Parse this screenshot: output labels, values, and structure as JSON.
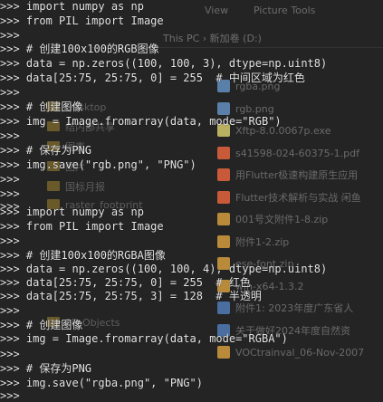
{
  "explorer": {
    "ribbon_tabs": [
      "View",
      "Picture Tools"
    ],
    "address_path": "This PC  ›  新加卷 (D:)",
    "nav_items": [
      "Desktop",
      "结内部共享",
      "图表",
      "图片",
      "国标月报",
      "raster_footprint",
      "3D Objects"
    ],
    "files": [
      {
        "name": "rgba.png",
        "icon": "png-icon",
        "color": "#5a7fa8"
      },
      {
        "name": "rgb.png",
        "icon": "png-icon",
        "color": "#5a7fa8"
      },
      {
        "name": "Xftp-8.0.0067p.exe",
        "icon": "exe-icon",
        "color": "#b9b062"
      },
      {
        "name": "s41598-024-60375-1.pdf",
        "icon": "pdf-icon",
        "color": "#c85a3a"
      },
      {
        "name": "用Flutter极速构建原生应用",
        "icon": "pdf-icon",
        "color": "#c85a3a"
      },
      {
        "name": "Flutter技术解析与实战 闲鱼",
        "icon": "pdf-icon",
        "color": "#c85a3a"
      },
      {
        "name": "001号文附件1-8.zip",
        "icon": "zip-icon",
        "color": "#b88a3a"
      },
      {
        "name": "附件1-2.zip",
        "icon": "zip-icon",
        "color": "#b88a3a"
      },
      {
        "name": "ese-font.zip",
        "icon": "zip-icon",
        "color": "#b88a3a"
      },
      {
        "name": "win-x64-1.3.2",
        "icon": "zip-icon",
        "color": "#b88a3a"
      },
      {
        "name": "附件1: 2023年度广东省人",
        "icon": "doc-icon",
        "color": "#4a6ea0"
      },
      {
        "name": "关于做好2024年度自然资",
        "icon": "doc-icon",
        "color": "#4a6ea0"
      },
      {
        "name": "VOCtrainval_06-Nov-2007",
        "icon": "zip-icon",
        "color": "#b88a3a"
      }
    ]
  },
  "console": {
    "lines": [
      ">>> import numpy as np",
      ">>> from PIL import Image",
      ">>>",
      ">>> # 创建100x100的RGB图像",
      ">>> data = np.zeros((100, 100, 3), dtype=np.uint8)",
      ">>> data[25:75, 25:75, 0] = 255  # 中间区域为红色",
      ">>>",
      ">>> # 创建图像",
      ">>> img = Image.fromarray(data, mode=\"RGB\")",
      ">>>",
      ">>> # 保存为PNG",
      ">>> img.save(\"rgb.png\", \"PNG\")",
      ">>>",
      ">>>",
      ">>>",
      ">>> import numpy as np",
      ">>> from PIL import Image",
      ">>>",
      ">>> # 创建100x100的RGBA图像",
      ">>> data = np.zeros((100, 100, 4), dtype=np.uint8)",
      ">>> data[25:75, 25:75, 0] = 255  # 红色",
      ">>> data[25:75, 25:75, 3] = 128  # 半透明",
      ">>>",
      ">>> # 创建图像",
      ">>> img = Image.fromarray(data, mode=\"RGBA\")",
      ">>>",
      ">>> # 保存为PNG",
      ">>> img.save(\"rgba.png\", \"PNG\")",
      ">>>"
    ]
  }
}
